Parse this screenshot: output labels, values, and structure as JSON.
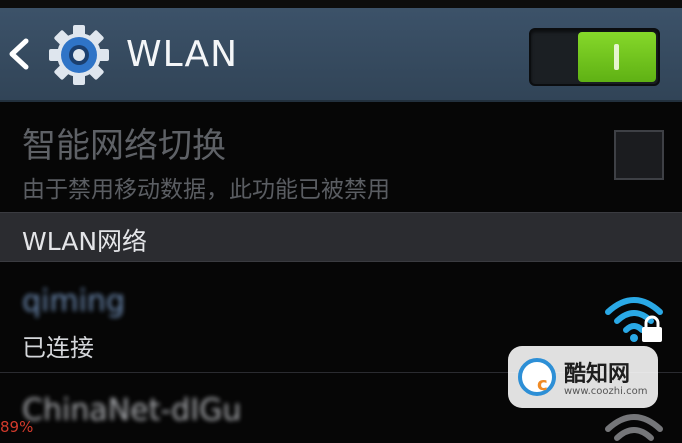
{
  "header": {
    "title": "WLAN",
    "toggle_on": true
  },
  "smart_switch": {
    "title": "智能网络切换",
    "subtitle": "由于禁用移动数据，此功能已被禁用",
    "checked": false
  },
  "section": {
    "title": "WLAN网络"
  },
  "networks": [
    {
      "ssid": "qiming",
      "status": "已连接",
      "secured": true
    },
    {
      "ssid": "ChinaNet-dIGu",
      "status": "",
      "secured": true
    }
  ],
  "watermark": {
    "name": "酷知网",
    "url": "www.coozhi.com"
  },
  "overlay": {
    "battery_percent": "89%"
  },
  "colors": {
    "action_bar": "#34495e",
    "toggle_on": "#6cc11c",
    "accent_blue": "#2d8fd6"
  }
}
